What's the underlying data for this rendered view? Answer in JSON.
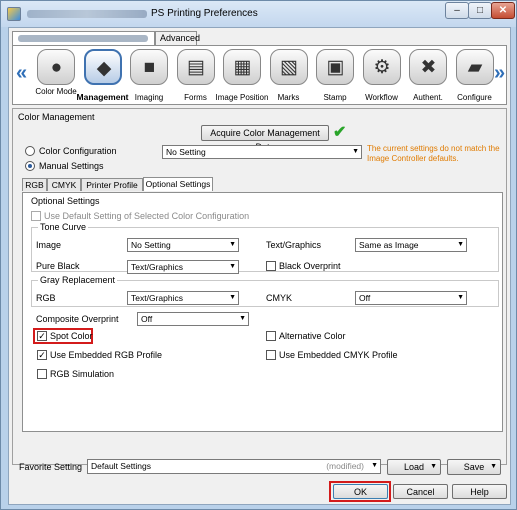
{
  "window": {
    "title": "PS Printing Preferences",
    "minimize": "–",
    "maximize": "□",
    "close": "✕"
  },
  "top_tabs": [
    "",
    "Advanced"
  ],
  "categories": [
    {
      "label": "Color Mode",
      "icon": "color-mode-icon",
      "glyph": "●"
    },
    {
      "label": "Management",
      "icon": "management-icon",
      "glyph": "◆"
    },
    {
      "label": "Imaging",
      "icon": "imaging-icon",
      "glyph": "■"
    },
    {
      "label": "Forms",
      "icon": "forms-icon",
      "glyph": "▤"
    },
    {
      "label": "Image Position",
      "icon": "image-position-icon",
      "glyph": "▦"
    },
    {
      "label": "Marks",
      "icon": "marks-icon",
      "glyph": "▧"
    },
    {
      "label": "Stamp",
      "icon": "stamp-icon",
      "glyph": "▣"
    },
    {
      "label": "Workflow",
      "icon": "workflow-icon",
      "glyph": "⚙"
    },
    {
      "label": "Authent.",
      "icon": "authent-icon",
      "glyph": "✖"
    },
    {
      "label": "Configure",
      "icon": "configure-icon",
      "glyph": "▰"
    }
  ],
  "color_mgmt": {
    "section_title": "Color Management",
    "acquire_button": "Acquire Color Management Data",
    "check_mark": "✔",
    "warning": "The current settings do not match the Image Controller defaults.",
    "color_config_label": "Color Configuration",
    "color_config_value": "No Setting",
    "manual_label": "Manual Settings"
  },
  "inner_tabs": [
    "RGB",
    "CMYK",
    "Printer Profile",
    "Optional Settings"
  ],
  "optional": {
    "group_title": "Optional Settings",
    "use_default": "Use Default Setting of Selected Color Configuration",
    "tone_curve": "Tone Curve",
    "image_label": "Image",
    "image_value": "No Setting",
    "text_graphics_label": "Text/Graphics",
    "text_graphics_value": "Same as Image",
    "pure_black_label": "Pure Black",
    "pure_black_value": "Text/Graphics",
    "black_overprint": "Black Overprint",
    "gray_replacement": "Gray Replacement",
    "rgb_label": "RGB",
    "rgb_value": "Text/Graphics",
    "cmyk_label": "CMYK",
    "cmyk_value": "Off",
    "composite_label": "Composite Overprint",
    "composite_value": "Off",
    "spot_color": "Spot Color",
    "alternative_color": "Alternative Color",
    "embedded_rgb": "Use Embedded RGB Profile",
    "embedded_cmyk": "Use Embedded CMYK Profile",
    "rgb_simulation": "RGB Simulation"
  },
  "favorite": {
    "label": "Favorite Setting",
    "value": "Default Settings",
    "modified": "(modified)",
    "load": "Load",
    "save": "Save"
  },
  "buttons": {
    "ok": "OK",
    "cancel": "Cancel",
    "help": "Help"
  },
  "glyphs": {
    "dropdown": "▼",
    "check": "✓",
    "left": "«",
    "right": "»"
  }
}
